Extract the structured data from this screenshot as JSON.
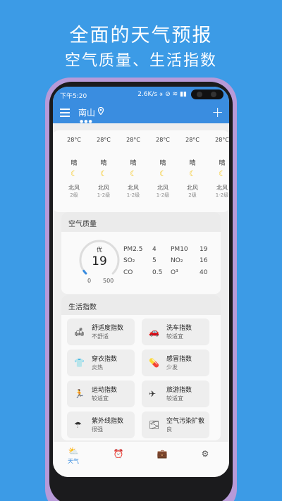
{
  "promo": {
    "line1": "全面的天气预报",
    "line2": "空气质量、生活指数"
  },
  "status_bar": {
    "time": "下午5:20",
    "right": "2.6K/s ⚹ ⊘ ≋ ▮▮"
  },
  "app_bar": {
    "city": "南山",
    "page_dots": "●●●",
    "plus": "+"
  },
  "forecast": [
    {
      "temp": "28°C",
      "cond": "晴",
      "wind": "北风",
      "level": "2级"
    },
    {
      "temp": "28°C",
      "cond": "晴",
      "wind": "北风",
      "level": "1-2级"
    },
    {
      "temp": "28°C",
      "cond": "晴",
      "wind": "北风",
      "level": "1-2级"
    },
    {
      "temp": "28°C",
      "cond": "晴",
      "wind": "北风",
      "level": "1-2级"
    },
    {
      "temp": "28°C",
      "cond": "晴",
      "wind": "北风",
      "level": "2级"
    },
    {
      "temp": "28°C",
      "cond": "晴",
      "wind": "北风",
      "level": "1-2级"
    }
  ],
  "air_quality": {
    "title": "空气质量",
    "level": "优",
    "value": "19",
    "min": "0",
    "max": "500",
    "gauge_fraction": 0.038,
    "pollutants": [
      {
        "name": "PM2.5",
        "value": "4"
      },
      {
        "name": "PM10",
        "value": "19"
      },
      {
        "name": "SO₂",
        "value": "5"
      },
      {
        "name": "NO₂",
        "value": "16"
      },
      {
        "name": "CO",
        "value": "0.5"
      },
      {
        "name": "O³",
        "value": "40"
      }
    ]
  },
  "life_index": {
    "title": "生活指数",
    "items": [
      {
        "name": "舒适度指数",
        "value": "不舒适",
        "icon": "sofa-icon"
      },
      {
        "name": "洗车指数",
        "value": "较适宜",
        "icon": "car-icon"
      },
      {
        "name": "穿衣指数",
        "value": "炎热",
        "icon": "shirt-icon"
      },
      {
        "name": "感冒指数",
        "value": "少发",
        "icon": "pill-icon"
      },
      {
        "name": "运动指数",
        "value": "较适宜",
        "icon": "running-icon"
      },
      {
        "name": "旅游指数",
        "value": "较适宜",
        "icon": "airplane-icon"
      },
      {
        "name": "紫外线指数",
        "value": "很强",
        "icon": "umbrella-icon"
      },
      {
        "name": "空气污染扩散",
        "value": "良",
        "icon": "pollution-icon"
      }
    ]
  },
  "bottom_nav": {
    "weather_label": "天气"
  },
  "colors": {
    "accent": "#3a8de0",
    "background": "#3c9be6",
    "phone_frame": "#b79ad8",
    "moon": "#f4c20d"
  }
}
